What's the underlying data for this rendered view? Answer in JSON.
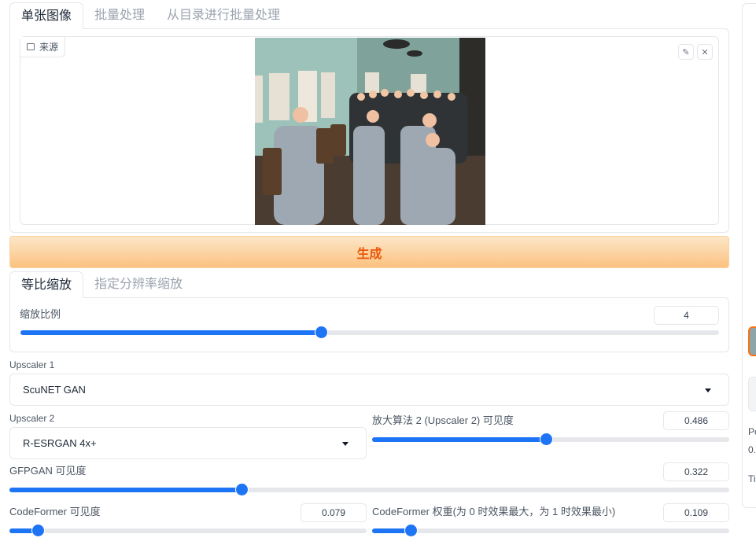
{
  "top_tabs": [
    "单张图像",
    "批量处理",
    "从目录进行批量处理"
  ],
  "image_panel": {
    "label": "来源",
    "edit_icon": "pencil-icon",
    "close_icon": "close-icon"
  },
  "generate_label": "生成",
  "resize_tabs": [
    "等比缩放",
    "指定分辨率缩放"
  ],
  "scale": {
    "label": "缩放比例",
    "value": "4",
    "fraction": 0.43
  },
  "upscaler1": {
    "label": "Upscaler 1",
    "value": "ScuNET GAN"
  },
  "upscaler2": {
    "label": "Upscaler 2",
    "value": "R-ESRGAN 4x+"
  },
  "upscaler2_visibility": {
    "label": "放大算法 2 (Upscaler 2) 可见度",
    "value": "0.486",
    "fraction": 0.486
  },
  "gfpgan": {
    "label": "GFPGAN 可见度",
    "value": "0.322",
    "fraction": 0.322
  },
  "codeformer_visibility": {
    "label": "CodeFormer 可见度",
    "value": "0.079",
    "fraction": 0.079
  },
  "codeformer_weight": {
    "label": "CodeFormer 权重(为 0 时效果最大，为 1 时效果最小)",
    "value": "0.109",
    "fraction": 0.109
  },
  "right_panel": {
    "text1": "Po",
    "text2": "0.",
    "text3": "Ti"
  },
  "colors": {
    "accent": "#1d74f5",
    "generate_text": "#ea580c"
  }
}
